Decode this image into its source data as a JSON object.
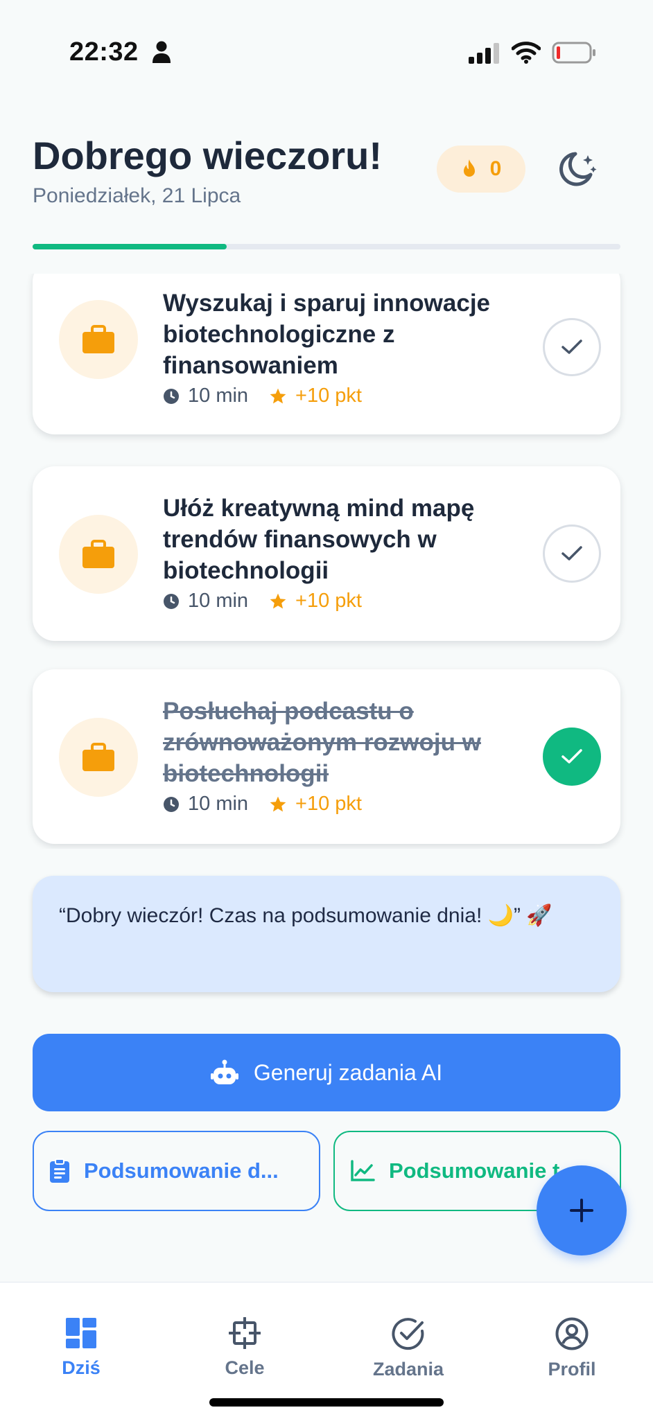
{
  "status_bar": {
    "time": "22:32"
  },
  "header": {
    "greeting": "Dobrego wieczoru!",
    "date": "Poniedziałek, 21 Lipca",
    "streak_count": "0",
    "progress": 0.33
  },
  "tasks": [
    {
      "title": "Wyszukaj i sparuj innowacje biotechnologiczne z finansowaniem",
      "duration": "10 min",
      "points": "+10 pkt",
      "done": false,
      "icon": "briefcase-icon"
    },
    {
      "title": "Ułóż kreatywną mind mapę trendów finansowych w biotechnologii",
      "duration": "10 min",
      "points": "+10 pkt",
      "done": false,
      "icon": "briefcase-icon"
    },
    {
      "title": "Posłuchaj podcastu o zrównoważonym rozwoju w biotechnologii",
      "duration": "10 min",
      "points": "+10 pkt",
      "done": true,
      "icon": "briefcase-icon"
    }
  ],
  "quote": "“Dobry wieczór! Czas na podsumowanie dnia! 🌙” 🚀",
  "actions": {
    "generate_ai": "Generuj zadania AI",
    "summary_day": "Podsumowanie d...",
    "summary_week": "Podsumowanie t"
  },
  "nav": [
    {
      "label": "Dziś",
      "icon": "dashboard-icon",
      "active": true
    },
    {
      "label": "Cele",
      "icon": "target-icon",
      "active": false
    },
    {
      "label": "Zadania",
      "icon": "check-circle-icon",
      "active": false
    },
    {
      "label": "Profil",
      "icon": "profile-icon",
      "active": false
    }
  ],
  "colors": {
    "accent": "#3b82f6",
    "success": "#10b981",
    "warning": "#f59e0b"
  }
}
